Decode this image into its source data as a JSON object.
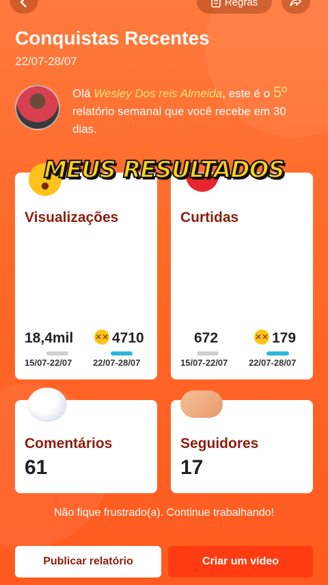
{
  "topbar": {
    "back_icon": "chevron-left-icon",
    "rules_label": "Regras",
    "rules_icon": "document-icon",
    "share_icon": "share-icon"
  },
  "header": {
    "title": "Conquistas Recentes",
    "date_range": "22/07-28/07"
  },
  "intro": {
    "prefix": "Olá ",
    "user_name": "Wesley Dos reis Almeida",
    "middle": ", este é o ",
    "ordinal": "5º",
    "suffix": " relatório semanal que você recebe em 30 dias."
  },
  "banner": {
    "text": "MEUS RESULTADOS"
  },
  "cards": {
    "views": {
      "title": "Visualizações",
      "icon": "surprised-face-icon",
      "prev_value": "18,4mil",
      "cur_value": "4710",
      "prev_period": "15/07-22/07",
      "cur_period": "22/07-28/07",
      "prev_bar_fraction": 1.0,
      "cur_bar_fraction": 0.26
    },
    "likes": {
      "title": "Curtidas",
      "icon": "heart-icon",
      "prev_value": "672",
      "cur_value": "179",
      "prev_period": "15/07-22/07",
      "cur_period": "22/07-28/07",
      "prev_bar_fraction": 1.0,
      "cur_bar_fraction": 0.27
    },
    "comments": {
      "title": "Comentários",
      "icon": "speech-bubble-icon",
      "value": "61"
    },
    "followers": {
      "title": "Seguidores",
      "icon": "handshake-icon",
      "value": "17"
    }
  },
  "footer": {
    "message": "Não fique frustrado(a). Continue trabalhando!",
    "publish_label": "Publicar relatório",
    "create_label": "Criar um vídeo"
  },
  "colors": {
    "background": "#ff6a2a",
    "title_dark_red": "#8a1e0e",
    "highlight_yellow": "#ffe37a",
    "bar_current": "#2bb7d9",
    "bar_previous": "#cfcfcf",
    "primary_button": "#ff3b12"
  }
}
